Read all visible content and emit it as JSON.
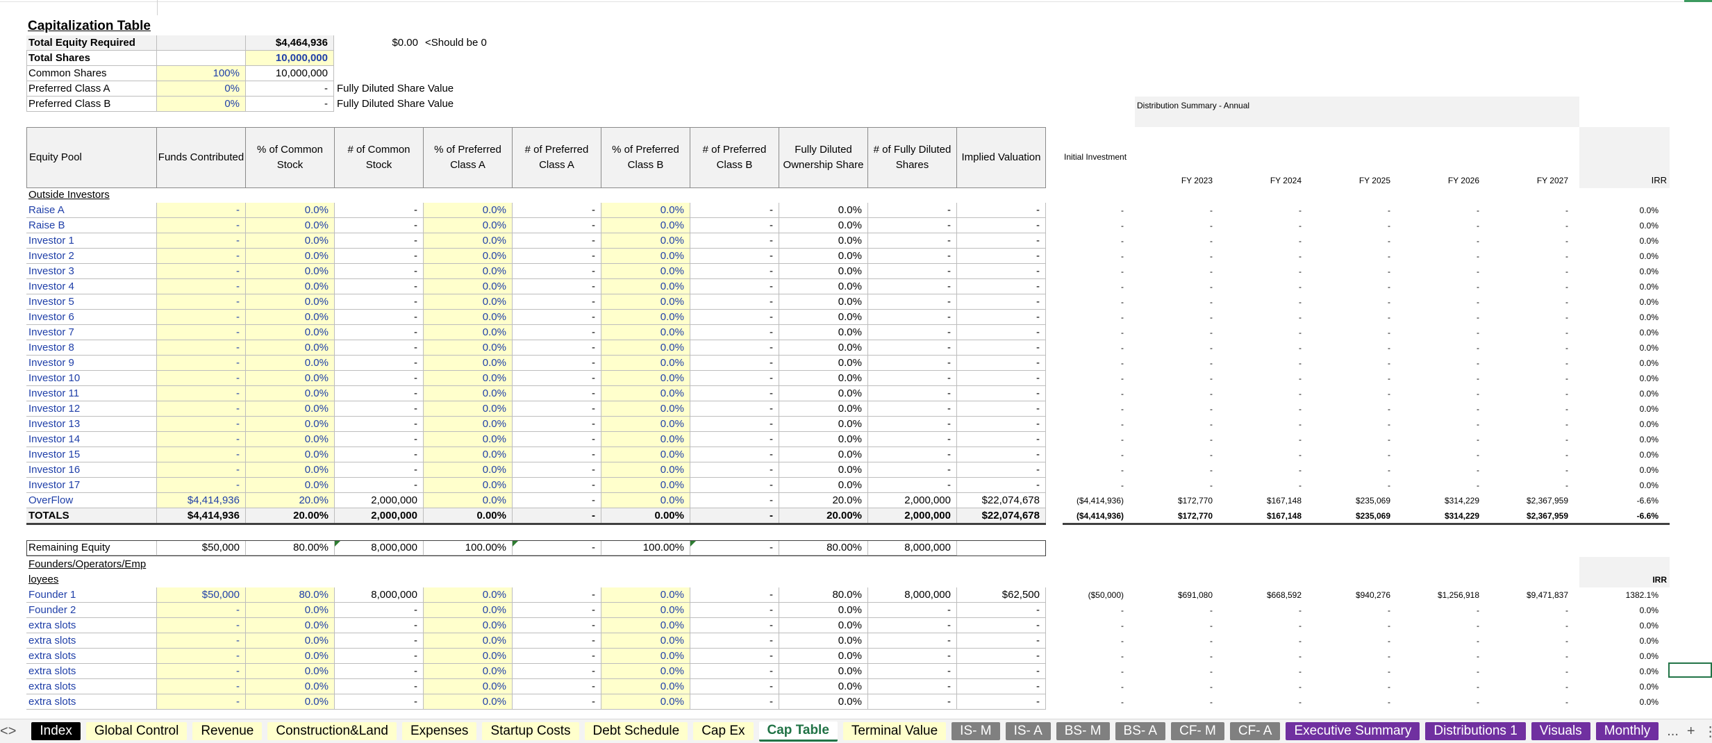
{
  "cap": {
    "title": "Capitalization Table",
    "total_equity_label": "Total Equity Required",
    "total_equity_value": "$4,464,936",
    "check_value": "$0.00",
    "check_note": "<Should be 0",
    "total_shares_label": "Total Shares",
    "total_shares_value": "10,000,000",
    "common_label": "Common Shares",
    "common_pct": "100%",
    "common_value": "10,000,000",
    "prefA_label": "Preferred Class A",
    "prefA_pct": "0%",
    "prefA_value": "-",
    "prefA_note": "Fully Diluted Share Value",
    "prefB_label": "Preferred Class B",
    "prefB_pct": "0%",
    "prefB_value": "-",
    "prefB_note": "Fully Diluted Share Value"
  },
  "headers": [
    "Equity Pool",
    "Funds Contributed",
    "% of Common Stock",
    "# of Common Stock",
    "% of Preferred Class A",
    "# of Preferred Class A",
    "% of Preferred Class B",
    "# of Preferred Class B",
    "Fully Diluted Ownership Share",
    "# of Fully Diluted Shares",
    "Implied Valuation"
  ],
  "distribution": {
    "title": "Distribution Summary - Annual",
    "initial_investment": "Initial Investment",
    "years": [
      "FY 2023",
      "FY 2024",
      "FY 2025",
      "FY 2026",
      "FY 2027"
    ],
    "irr": "IRR",
    "irr2": "IRR"
  },
  "outside_label": "Outside Investors",
  "investors": [
    {
      "name": "Raise A",
      "c": [
        "-",
        "0.0%",
        "-",
        "0.0%",
        "-",
        "0.0%",
        "-",
        "0.0%",
        "-",
        "-"
      ],
      "d": [
        "-",
        "-",
        "-",
        "-",
        "-",
        "-",
        "0.0%"
      ]
    },
    {
      "name": "Raise B",
      "c": [
        "-",
        "0.0%",
        "-",
        "0.0%",
        "-",
        "0.0%",
        "-",
        "0.0%",
        "-",
        "-"
      ],
      "d": [
        "-",
        "-",
        "-",
        "-",
        "-",
        "-",
        "0.0%"
      ]
    },
    {
      "name": "Investor 1",
      "c": [
        "-",
        "0.0%",
        "-",
        "0.0%",
        "-",
        "0.0%",
        "-",
        "0.0%",
        "-",
        "-"
      ],
      "d": [
        "-",
        "-",
        "-",
        "-",
        "-",
        "-",
        "0.0%"
      ]
    },
    {
      "name": "Investor 2",
      "c": [
        "-",
        "0.0%",
        "-",
        "0.0%",
        "-",
        "0.0%",
        "-",
        "0.0%",
        "-",
        "-"
      ],
      "d": [
        "-",
        "-",
        "-",
        "-",
        "-",
        "-",
        "0.0%"
      ]
    },
    {
      "name": "Investor 3",
      "c": [
        "-",
        "0.0%",
        "-",
        "0.0%",
        "-",
        "0.0%",
        "-",
        "0.0%",
        "-",
        "-"
      ],
      "d": [
        "-",
        "-",
        "-",
        "-",
        "-",
        "-",
        "0.0%"
      ]
    },
    {
      "name": "Investor 4",
      "c": [
        "-",
        "0.0%",
        "-",
        "0.0%",
        "-",
        "0.0%",
        "-",
        "0.0%",
        "-",
        "-"
      ],
      "d": [
        "-",
        "-",
        "-",
        "-",
        "-",
        "-",
        "0.0%"
      ]
    },
    {
      "name": "Investor 5",
      "c": [
        "-",
        "0.0%",
        "-",
        "0.0%",
        "-",
        "0.0%",
        "-",
        "0.0%",
        "-",
        "-"
      ],
      "d": [
        "-",
        "-",
        "-",
        "-",
        "-",
        "-",
        "0.0%"
      ]
    },
    {
      "name": "Investor 6",
      "c": [
        "-",
        "0.0%",
        "-",
        "0.0%",
        "-",
        "0.0%",
        "-",
        "0.0%",
        "-",
        "-"
      ],
      "d": [
        "-",
        "-",
        "-",
        "-",
        "-",
        "-",
        "0.0%"
      ]
    },
    {
      "name": "Investor 7",
      "c": [
        "-",
        "0.0%",
        "-",
        "0.0%",
        "-",
        "0.0%",
        "-",
        "0.0%",
        "-",
        "-"
      ],
      "d": [
        "-",
        "-",
        "-",
        "-",
        "-",
        "-",
        "0.0%"
      ]
    },
    {
      "name": "Investor 8",
      "c": [
        "-",
        "0.0%",
        "-",
        "0.0%",
        "-",
        "0.0%",
        "-",
        "0.0%",
        "-",
        "-"
      ],
      "d": [
        "-",
        "-",
        "-",
        "-",
        "-",
        "-",
        "0.0%"
      ]
    },
    {
      "name": "Investor 9",
      "c": [
        "-",
        "0.0%",
        "-",
        "0.0%",
        "-",
        "0.0%",
        "-",
        "0.0%",
        "-",
        "-"
      ],
      "d": [
        "-",
        "-",
        "-",
        "-",
        "-",
        "-",
        "0.0%"
      ]
    },
    {
      "name": "Investor 10",
      "c": [
        "-",
        "0.0%",
        "-",
        "0.0%",
        "-",
        "0.0%",
        "-",
        "0.0%",
        "-",
        "-"
      ],
      "d": [
        "-",
        "-",
        "-",
        "-",
        "-",
        "-",
        "0.0%"
      ]
    },
    {
      "name": "Investor 11",
      "c": [
        "-",
        "0.0%",
        "-",
        "0.0%",
        "-",
        "0.0%",
        "-",
        "0.0%",
        "-",
        "-"
      ],
      "d": [
        "-",
        "-",
        "-",
        "-",
        "-",
        "-",
        "0.0%"
      ]
    },
    {
      "name": "Investor 12",
      "c": [
        "-",
        "0.0%",
        "-",
        "0.0%",
        "-",
        "0.0%",
        "-",
        "0.0%",
        "-",
        "-"
      ],
      "d": [
        "-",
        "-",
        "-",
        "-",
        "-",
        "-",
        "0.0%"
      ]
    },
    {
      "name": "Investor 13",
      "c": [
        "-",
        "0.0%",
        "-",
        "0.0%",
        "-",
        "0.0%",
        "-",
        "0.0%",
        "-",
        "-"
      ],
      "d": [
        "-",
        "-",
        "-",
        "-",
        "-",
        "-",
        "0.0%"
      ]
    },
    {
      "name": "Investor 14",
      "c": [
        "-",
        "0.0%",
        "-",
        "0.0%",
        "-",
        "0.0%",
        "-",
        "0.0%",
        "-",
        "-"
      ],
      "d": [
        "-",
        "-",
        "-",
        "-",
        "-",
        "-",
        "0.0%"
      ]
    },
    {
      "name": "Investor 15",
      "c": [
        "-",
        "0.0%",
        "-",
        "0.0%",
        "-",
        "0.0%",
        "-",
        "0.0%",
        "-",
        "-"
      ],
      "d": [
        "-",
        "-",
        "-",
        "-",
        "-",
        "-",
        "0.0%"
      ]
    },
    {
      "name": "Investor 16",
      "c": [
        "-",
        "0.0%",
        "-",
        "0.0%",
        "-",
        "0.0%",
        "-",
        "0.0%",
        "-",
        "-"
      ],
      "d": [
        "-",
        "-",
        "-",
        "-",
        "-",
        "-",
        "0.0%"
      ]
    },
    {
      "name": "Investor 17",
      "c": [
        "-",
        "0.0%",
        "-",
        "0.0%",
        "-",
        "0.0%",
        "-",
        "0.0%",
        "-",
        "-"
      ],
      "d": [
        "-",
        "-",
        "-",
        "-",
        "-",
        "-",
        "0.0%"
      ]
    },
    {
      "name": "OverFlow",
      "c": [
        "$4,414,936",
        "20.0%",
        "2,000,000",
        "0.0%",
        "-",
        "0.0%",
        "-",
        "20.0%",
        "2,000,000",
        "$22,074,678"
      ],
      "d": [
        "($4,414,936)",
        "$172,770",
        "$167,148",
        "$235,069",
        "$314,229",
        "$2,367,959",
        "-6.6%"
      ]
    }
  ],
  "totals": {
    "name": "TOTALS",
    "c": [
      "$4,414,936",
      "20.00%",
      "2,000,000",
      "0.00%",
      "-",
      "0.00%",
      "-",
      "20.00%",
      "2,000,000",
      "$22,074,678"
    ],
    "d": [
      "($4,414,936)",
      "$172,770",
      "$167,148",
      "$235,069",
      "$314,229",
      "$2,367,959",
      "-6.6%"
    ]
  },
  "remaining": {
    "name": "Remaining Equity",
    "c": [
      "$50,000",
      "80.00%",
      "8,000,000",
      "100.00%",
      "-",
      "100.00%",
      "-",
      "80.00%",
      "8,000,000"
    ]
  },
  "founders_label": "Founders/Operators/Emp",
  "founders_label2": "loyees",
  "founders": [
    {
      "name": "Founder 1",
      "c": [
        "$50,000",
        "80.0%",
        "8,000,000",
        "0.0%",
        "-",
        "0.0%",
        "-",
        "80.0%",
        "8,000,000",
        "$62,500"
      ],
      "d": [
        "($50,000)",
        "$691,080",
        "$668,592",
        "$940,276",
        "$1,256,918",
        "$9,471,837",
        "1382.1%"
      ]
    },
    {
      "name": "Founder 2",
      "c": [
        "-",
        "0.0%",
        "-",
        "0.0%",
        "-",
        "0.0%",
        "-",
        "0.0%",
        "-",
        "-"
      ],
      "d": [
        "-",
        "-",
        "-",
        "-",
        "-",
        "-",
        "0.0%"
      ]
    },
    {
      "name": "extra slots",
      "c": [
        "-",
        "0.0%",
        "-",
        "0.0%",
        "-",
        "0.0%",
        "-",
        "0.0%",
        "-",
        "-"
      ],
      "d": [
        "-",
        "-",
        "-",
        "-",
        "-",
        "-",
        "0.0%"
      ]
    },
    {
      "name": "extra slots",
      "c": [
        "-",
        "0.0%",
        "-",
        "0.0%",
        "-",
        "0.0%",
        "-",
        "0.0%",
        "-",
        "-"
      ],
      "d": [
        "-",
        "-",
        "-",
        "-",
        "-",
        "-",
        "0.0%"
      ]
    },
    {
      "name": "extra slots",
      "c": [
        "-",
        "0.0%",
        "-",
        "0.0%",
        "-",
        "0.0%",
        "-",
        "0.0%",
        "-",
        "-"
      ],
      "d": [
        "-",
        "-",
        "-",
        "-",
        "-",
        "-",
        "0.0%"
      ]
    },
    {
      "name": "extra slots",
      "c": [
        "-",
        "0.0%",
        "-",
        "0.0%",
        "-",
        "0.0%",
        "-",
        "0.0%",
        "-",
        "-"
      ],
      "d": [
        "-",
        "-",
        "-",
        "-",
        "-",
        "-",
        "0.0%"
      ]
    },
    {
      "name": "extra slots",
      "c": [
        "-",
        "0.0%",
        "-",
        "0.0%",
        "-",
        "0.0%",
        "-",
        "0.0%",
        "-",
        "-"
      ],
      "d": [
        "-",
        "-",
        "-",
        "-",
        "-",
        "-",
        "0.0%"
      ]
    },
    {
      "name": "extra slots",
      "c": [
        "-",
        "0.0%",
        "-",
        "0.0%",
        "-",
        "0.0%",
        "-",
        "0.0%",
        "-",
        "-"
      ],
      "d": [
        "-",
        "-",
        "-",
        "-",
        "-",
        "-",
        "0.0%"
      ]
    }
  ],
  "tabs": [
    {
      "label": "Index",
      "style": "dark"
    },
    {
      "label": "Global Control",
      "style": "yellow"
    },
    {
      "label": "Revenue",
      "style": "yellow"
    },
    {
      "label": "Construction&Land",
      "style": "yellow"
    },
    {
      "label": "Expenses",
      "style": "yellow"
    },
    {
      "label": "Startup Costs",
      "style": "yellow"
    },
    {
      "label": "Debt Schedule",
      "style": "yellow"
    },
    {
      "label": "Cap Ex",
      "style": "yellow"
    },
    {
      "label": "Cap Table",
      "style": "active"
    },
    {
      "label": "Terminal Value",
      "style": "yellow"
    },
    {
      "label": "IS- M",
      "style": "gray"
    },
    {
      "label": "IS- A",
      "style": "gray"
    },
    {
      "label": "BS- M",
      "style": "gray"
    },
    {
      "label": "BS- A",
      "style": "gray"
    },
    {
      "label": "CF- M",
      "style": "gray"
    },
    {
      "label": "CF- A",
      "style": "gray"
    },
    {
      "label": "Executive Summary",
      "style": "purple"
    },
    {
      "label": "Distributions 1",
      "style": "purple"
    },
    {
      "label": "Visuals",
      "style": "purple"
    },
    {
      "label": "Monthly",
      "style": "purple"
    }
  ],
  "tab_nav": {
    "prev": "<",
    "next": ">",
    "more": "...",
    "add": "+",
    "options": "⋮"
  },
  "colors": {
    "yellow": "#ffffcc",
    "gray_header": "#f2f2f2",
    "blue_text": "#1f3fa8",
    "tab_purple": "#7030a0",
    "tab_gray": "#808080",
    "tab_yellow": "#ffffcc",
    "tab_dark": "#000000",
    "active_tab_green": "#217346"
  }
}
